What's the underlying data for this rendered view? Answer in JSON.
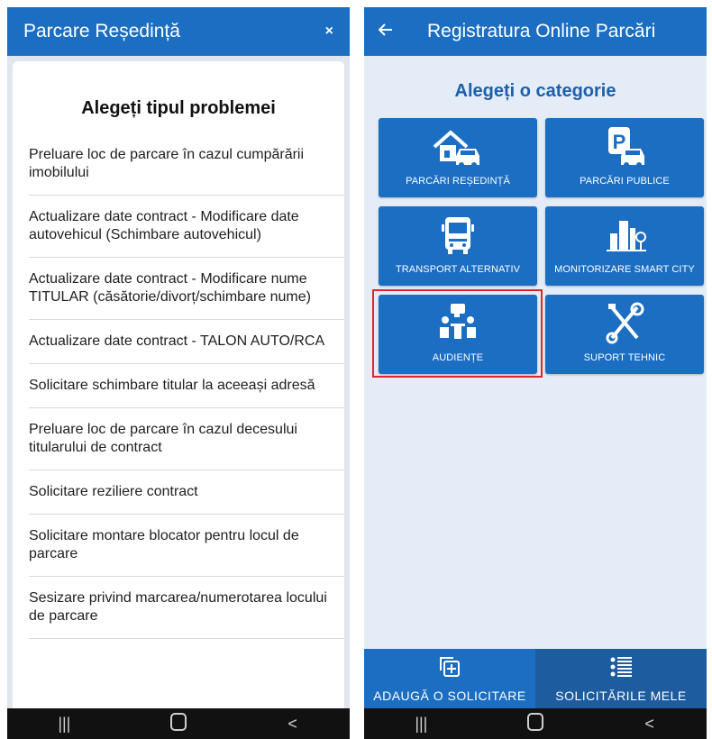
{
  "left_screen": {
    "header": {
      "title": "Parcare Reședință",
      "close_label": "×"
    },
    "sheet_title": "Alegeți tipul problemei",
    "options": [
      "Preluare loc de parcare în cazul cumpărării imobilului",
      "Actualizare date contract - Modificare date autovehicul (Schimbare autovehicul)",
      "Actualizare date contract - Modificare nume TITULAR (căsătorie/divorț/schimbare nume)",
      "Actualizare date contract - TALON AUTO/RCA",
      "Solicitare schimbare titular la aceeași adresă",
      "Preluare loc de parcare în cazul decesului titularului de contract",
      "Solicitare reziliere contract",
      "Solicitare montare blocator pentru locul de parcare",
      "Sesizare privind marcarea/numerotarea locului de parcare"
    ]
  },
  "right_screen": {
    "header": {
      "back_icon": "arrow-left-icon",
      "title": "Registratura Online Parcări"
    },
    "subtitle": "Alegeți o categorie",
    "categories": [
      {
        "label": "PARCĂRI REȘEDINȚĂ",
        "icon": "house-car-icon"
      },
      {
        "label": "PARCĂRI PUBLICE",
        "icon": "parking-car-icon"
      },
      {
        "label": "TRANSPORT ALTERNATIV",
        "icon": "bus-icon"
      },
      {
        "label": "MONITORIZARE SMART CITY",
        "icon": "city-icon"
      },
      {
        "label": "AUDIENȚE",
        "icon": "meeting-icon",
        "highlighted": true
      },
      {
        "label": "SUPORT TEHNIC",
        "icon": "tools-icon"
      }
    ],
    "bottom_tabs": [
      {
        "label": "ADAUGĂ O SOLICITARE",
        "icon": "add-copy-icon"
      },
      {
        "label": "SOLICITĂRILE MELE",
        "icon": "list-icon"
      }
    ]
  },
  "system_nav": {
    "recents_label": "|||",
    "back_label": "<"
  },
  "colors": {
    "primary": "#1b6ec2",
    "primary_dark": "#1d5c9f",
    "highlight": "#e0262c",
    "nav_bar": "#111111"
  }
}
